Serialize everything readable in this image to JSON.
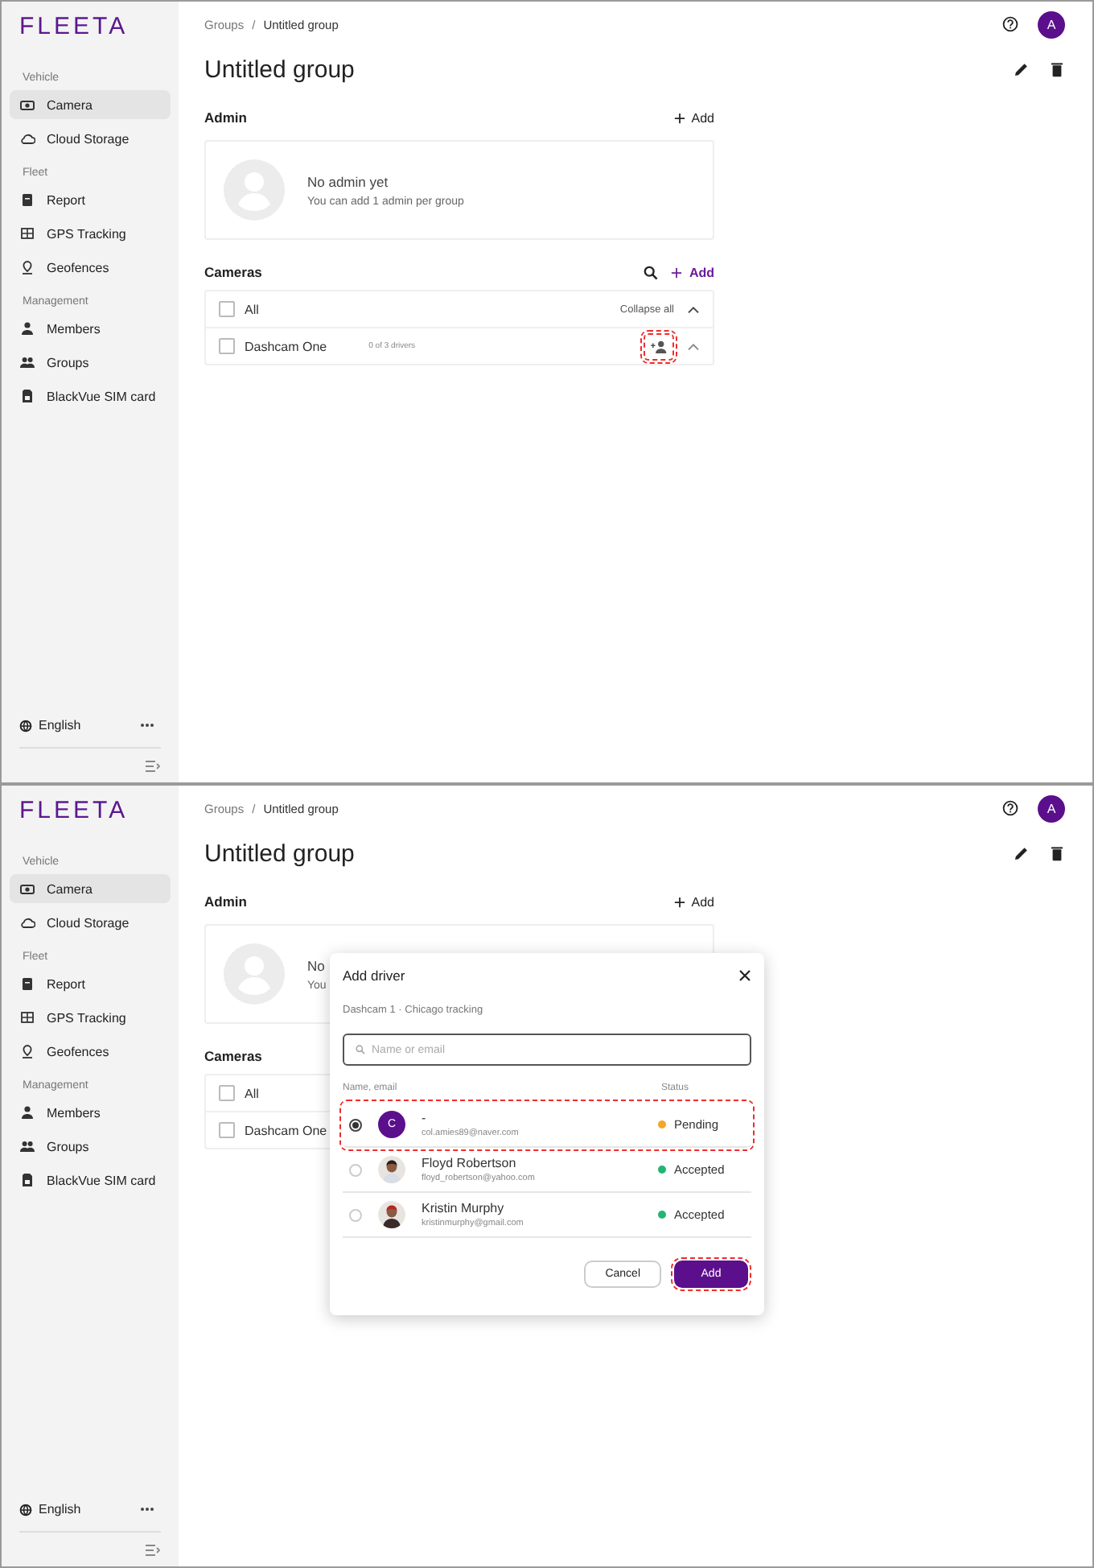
{
  "screens": [
    {
      "sidebar": {
        "logo": "FLEETA",
        "sections": [
          {
            "label": "Vehicle",
            "items": [
              {
                "label": "Camera",
                "kind": "camera",
                "selected": true
              },
              {
                "label": "Cloud Storage",
                "kind": "cloud",
                "selected": false
              }
            ]
          },
          {
            "label": "Fleet",
            "items": [
              {
                "label": "Report",
                "kind": "report",
                "selected": false
              },
              {
                "label": "GPS Tracking",
                "kind": "gps",
                "selected": false
              },
              {
                "label": "Geofences",
                "kind": "geofence",
                "selected": false
              }
            ]
          },
          {
            "label": "Management",
            "items": [
              {
                "label": "Members",
                "kind": "member",
                "selected": false
              },
              {
                "label": "Groups",
                "kind": "groups",
                "selected": false
              },
              {
                "label": "BlackVue SIM card",
                "kind": "sim",
                "selected": false
              }
            ]
          }
        ],
        "language": "English"
      },
      "breadcrumb": [
        "Groups",
        "/",
        "Untitled group"
      ],
      "avatar": "A",
      "title": "Untitled group",
      "admin": {
        "label": "Admin",
        "add": "Add",
        "empty_title": "No admin yet",
        "empty_text": "You can add 1 admin per group"
      },
      "cameras": {
        "label": "Cameras",
        "add": "Add",
        "all": {
          "label": "All",
          "checked": false
        },
        "collapse": "Collapse all",
        "rows": [
          {
            "name": "Dashcam One",
            "drivers": "0 of 3 drivers",
            "checked": false,
            "highlighted": true
          }
        ]
      }
    },
    {
      "sidebar": {
        "logo": "FLEETA",
        "sections": [
          {
            "label": "Vehicle",
            "items": [
              {
                "label": "Camera",
                "kind": "camera",
                "selected": true
              },
              {
                "label": "Cloud Storage",
                "kind": "cloud",
                "selected": false
              }
            ]
          },
          {
            "label": "Fleet",
            "items": [
              {
                "label": "Report",
                "kind": "report",
                "selected": false
              },
              {
                "label": "GPS Tracking",
                "kind": "gps",
                "selected": false
              },
              {
                "label": "Geofences",
                "kind": "geofence",
                "selected": false
              }
            ]
          },
          {
            "label": "Management",
            "items": [
              {
                "label": "Members",
                "kind": "member",
                "selected": false
              },
              {
                "label": "Groups",
                "kind": "groups",
                "selected": false
              },
              {
                "label": "BlackVue SIM card",
                "kind": "sim",
                "selected": false
              }
            ]
          }
        ],
        "language": "English"
      },
      "breadcrumb": [
        "Groups",
        "/",
        "Untitled group"
      ],
      "avatar": "A",
      "title": "Untitled group",
      "admin": {
        "label": "Admin",
        "add": "Add",
        "empty_title": "No",
        "empty_text": "You"
      },
      "cameras": {
        "label": "Cameras",
        "all": {
          "label": "All",
          "checked": false
        },
        "rows": [
          {
            "name": "Dashcam One",
            "checked": false
          }
        ]
      },
      "dialog": {
        "title": "Add driver",
        "subtitle": "Dashcam 1 · Chicago tracking",
        "search_placeholder": "Name or email",
        "columns": [
          "Name, email",
          "Status"
        ],
        "drivers": [
          {
            "kind": "initial",
            "initial": "C",
            "name": "-",
            "email": "col.amies89@naver.com",
            "selected": true,
            "status": "Pending",
            "color": "#f5a623",
            "highlighted": true
          },
          {
            "name": "Floyd Robertson",
            "email": "floyd_robertson@yahoo.com",
            "selected": false,
            "status": "Accepted",
            "color": "#22b573",
            "highlighted": false
          },
          {
            "name": "Kristin Murphy",
            "email": "kristinmurphy@gmail.com",
            "selected": false,
            "status": "Accepted",
            "color": "#22b573",
            "highlighted": false
          }
        ],
        "buttons": [
          {
            "label": "Cancel",
            "kind": "secondary",
            "highlighted": false
          },
          {
            "label": "Add",
            "kind": "primary",
            "highlighted": true
          }
        ]
      }
    }
  ]
}
